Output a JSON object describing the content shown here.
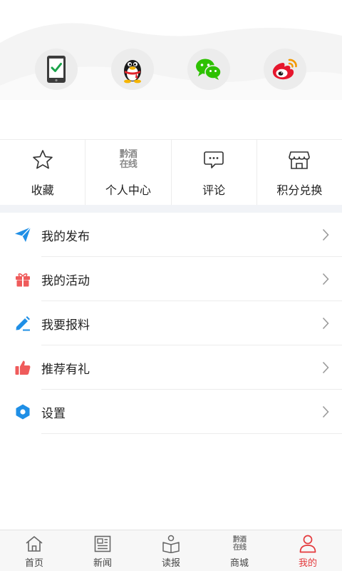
{
  "login": {
    "options": [
      {
        "name": "phone-login",
        "icon": "phone-check-icon"
      },
      {
        "name": "qq-login",
        "icon": "qq-penguin-icon"
      },
      {
        "name": "wechat-login",
        "icon": "wechat-icon"
      },
      {
        "name": "weibo-login",
        "icon": "weibo-icon"
      }
    ]
  },
  "quick": {
    "items": [
      {
        "label": "收藏",
        "icon": "star-icon"
      },
      {
        "label": "个人中心",
        "icon": "qianjiu-logo-icon",
        "logo_top": "黔酒",
        "logo_bottom": "在线"
      },
      {
        "label": "评论",
        "icon": "comment-icon"
      },
      {
        "label": "积分兑换",
        "icon": "store-icon"
      }
    ]
  },
  "menu": {
    "items": [
      {
        "label": "我的发布",
        "icon": "paper-plane-icon",
        "color": "#1f8fe6"
      },
      {
        "label": "我的活动",
        "icon": "gift-icon",
        "color": "#ef5b5b"
      },
      {
        "label": "我要报料",
        "icon": "pencil-icon",
        "color": "#1f8fe6"
      },
      {
        "label": "推荐有礼",
        "icon": "thumbs-up-icon",
        "color": "#ef5b5b"
      },
      {
        "label": "设置",
        "icon": "hexagon-settings-icon",
        "color": "#1f8fe6"
      }
    ]
  },
  "tabbar": {
    "active_color": "#e4393c",
    "items": [
      {
        "label": "首页",
        "icon": "home-icon",
        "active": false
      },
      {
        "label": "新闻",
        "icon": "newspaper-icon",
        "active": false
      },
      {
        "label": "读报",
        "icon": "read-paper-icon",
        "active": false
      },
      {
        "label": "商城",
        "icon": "qianjiu-logo-icon",
        "logo_top": "黔酒",
        "logo_bottom": "在线",
        "active": false
      },
      {
        "label": "我的",
        "icon": "person-icon",
        "active": true
      }
    ]
  }
}
